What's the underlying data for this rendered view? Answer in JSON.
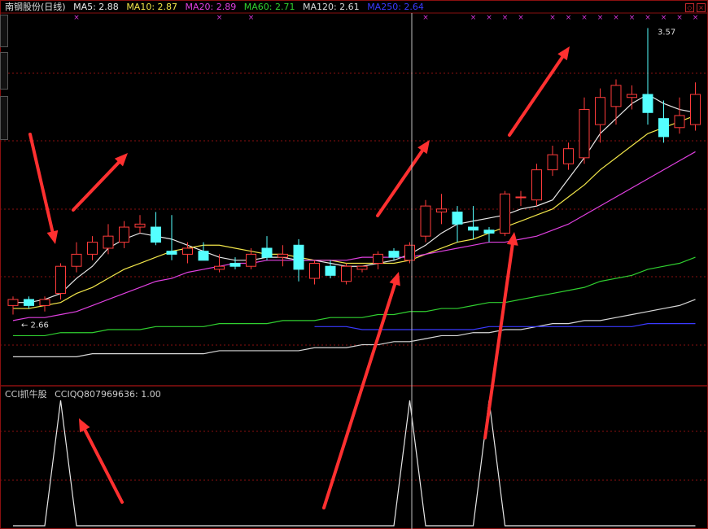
{
  "header": {
    "title": "南钢股份(日线)",
    "ma_items": [
      {
        "label": "MA5: 2.88",
        "color": "#e8e8e8"
      },
      {
        "label": "MA10: 2.87",
        "color": "#f2e64a"
      },
      {
        "label": "MA20: 2.89",
        "color": "#e040e0"
      },
      {
        "label": "MA60: 2.71",
        "color": "#30d030"
      },
      {
        "label": "MA120: 2.61",
        "color": "#d8d8d8"
      },
      {
        "label": "MA250: 2.64",
        "color": "#3a3aff"
      }
    ]
  },
  "indicator": {
    "name": "CCI抓牛股",
    "value_label": "CCIQQ807969636: 1.00"
  },
  "annotations": {
    "low_label": "2.66",
    "high_label": "3.57"
  },
  "colors": {
    "up": "#ff3b3b",
    "down": "#54ffff",
    "grid": "#8a1010",
    "crosshair": "#bfbfbf",
    "marker": "#d838d8",
    "arrow": "#ff3030"
  },
  "chart_data": {
    "type": "candlestick",
    "title": "南钢股份(日线)",
    "price_range": [
      2.4,
      3.62
    ],
    "candles": [
      {
        "o": 2.65,
        "h": 2.68,
        "l": 2.62,
        "c": 2.67,
        "up": true
      },
      {
        "o": 2.67,
        "h": 2.68,
        "l": 2.64,
        "c": 2.65,
        "up": false
      },
      {
        "o": 2.65,
        "h": 2.68,
        "l": 2.63,
        "c": 2.67,
        "up": true
      },
      {
        "o": 2.69,
        "h": 2.79,
        "l": 2.67,
        "c": 2.78,
        "up": true
      },
      {
        "o": 2.78,
        "h": 2.86,
        "l": 2.76,
        "c": 2.82,
        "up": true
      },
      {
        "o": 2.82,
        "h": 2.88,
        "l": 2.8,
        "c": 2.86,
        "up": true
      },
      {
        "o": 2.84,
        "h": 2.92,
        "l": 2.82,
        "c": 2.88,
        "up": true
      },
      {
        "o": 2.86,
        "h": 2.93,
        "l": 2.84,
        "c": 2.91,
        "up": true
      },
      {
        "o": 2.91,
        "h": 2.95,
        "l": 2.89,
        "c": 2.92,
        "up": true
      },
      {
        "o": 2.91,
        "h": 2.96,
        "l": 2.85,
        "c": 2.86,
        "up": false
      },
      {
        "o": 2.83,
        "h": 2.95,
        "l": 2.8,
        "c": 2.82,
        "up": false
      },
      {
        "o": 2.82,
        "h": 2.86,
        "l": 2.79,
        "c": 2.84,
        "up": true
      },
      {
        "o": 2.83,
        "h": 2.86,
        "l": 2.8,
        "c": 2.8,
        "up": false
      },
      {
        "o": 2.78,
        "h": 2.82,
        "l": 2.76,
        "c": 2.77,
        "up": true
      },
      {
        "o": 2.79,
        "h": 2.81,
        "l": 2.77,
        "c": 2.78,
        "up": false
      },
      {
        "o": 2.78,
        "h": 2.84,
        "l": 2.77,
        "c": 2.82,
        "up": true
      },
      {
        "o": 2.84,
        "h": 2.88,
        "l": 2.8,
        "c": 2.81,
        "up": false
      },
      {
        "o": 2.81,
        "h": 2.85,
        "l": 2.78,
        "c": 2.82,
        "up": true
      },
      {
        "o": 2.85,
        "h": 2.87,
        "l": 2.73,
        "c": 2.77,
        "up": false
      },
      {
        "o": 2.74,
        "h": 2.8,
        "l": 2.72,
        "c": 2.79,
        "up": true
      },
      {
        "o": 2.78,
        "h": 2.8,
        "l": 2.74,
        "c": 2.75,
        "up": false
      },
      {
        "o": 2.73,
        "h": 2.79,
        "l": 2.72,
        "c": 2.78,
        "up": true
      },
      {
        "o": 2.77,
        "h": 2.78,
        "l": 2.76,
        "c": 2.78,
        "up": true
      },
      {
        "o": 2.79,
        "h": 2.83,
        "l": 2.77,
        "c": 2.82,
        "up": true
      },
      {
        "o": 2.83,
        "h": 2.84,
        "l": 2.8,
        "c": 2.81,
        "up": false
      },
      {
        "o": 2.8,
        "h": 2.86,
        "l": 2.79,
        "c": 2.85,
        "up": true
      },
      {
        "o": 2.88,
        "h": 3.0,
        "l": 2.86,
        "c": 2.98,
        "up": true
      },
      {
        "o": 2.96,
        "h": 3.02,
        "l": 2.92,
        "c": 2.97,
        "up": true
      },
      {
        "o": 2.96,
        "h": 2.98,
        "l": 2.86,
        "c": 2.92,
        "up": false
      },
      {
        "o": 2.91,
        "h": 2.98,
        "l": 2.87,
        "c": 2.9,
        "up": false
      },
      {
        "o": 2.9,
        "h": 2.91,
        "l": 2.86,
        "c": 2.89,
        "up": false
      },
      {
        "o": 2.89,
        "h": 3.03,
        "l": 2.88,
        "c": 3.02,
        "up": true
      },
      {
        "o": 3.01,
        "h": 3.03,
        "l": 2.98,
        "c": 3.01,
        "up": true
      },
      {
        "o": 3.0,
        "h": 3.12,
        "l": 2.98,
        "c": 3.1,
        "up": true
      },
      {
        "o": 3.1,
        "h": 3.18,
        "l": 3.08,
        "c": 3.15,
        "up": true
      },
      {
        "o": 3.12,
        "h": 3.19,
        "l": 3.1,
        "c": 3.17,
        "up": true
      },
      {
        "o": 3.14,
        "h": 3.34,
        "l": 3.12,
        "c": 3.3,
        "up": true
      },
      {
        "o": 3.25,
        "h": 3.37,
        "l": 3.19,
        "c": 3.34,
        "up": true
      },
      {
        "o": 3.31,
        "h": 3.4,
        "l": 3.25,
        "c": 3.38,
        "up": true
      },
      {
        "o": 3.34,
        "h": 3.38,
        "l": 3.3,
        "c": 3.35,
        "up": true
      },
      {
        "o": 3.35,
        "h": 3.57,
        "l": 3.25,
        "c": 3.29,
        "up": false
      },
      {
        "o": 3.27,
        "h": 3.33,
        "l": 3.19,
        "c": 3.21,
        "up": false
      },
      {
        "o": 3.24,
        "h": 3.34,
        "l": 3.22,
        "c": 3.28,
        "up": true
      },
      {
        "o": 3.25,
        "h": 3.39,
        "l": 3.23,
        "c": 3.35,
        "up": true
      }
    ],
    "moving_averages": [
      {
        "name": "MA5",
        "values": [
          2.66,
          2.66,
          2.67,
          2.69,
          2.74,
          2.78,
          2.84,
          2.87,
          2.89,
          2.88,
          2.87,
          2.85,
          2.83,
          2.81,
          2.8,
          2.8,
          2.81,
          2.81,
          2.8,
          2.8,
          2.79,
          2.78,
          2.78,
          2.79,
          2.8,
          2.82,
          2.85,
          2.89,
          2.92,
          2.93,
          2.94,
          2.95,
          2.97,
          2.98,
          3.0,
          3.07,
          3.14,
          3.22,
          3.27,
          3.32,
          3.35,
          3.32,
          3.3,
          3.29
        ]
      },
      {
        "name": "MA10",
        "values": [
          2.64,
          2.64,
          2.65,
          2.66,
          2.69,
          2.71,
          2.74,
          2.77,
          2.79,
          2.81,
          2.83,
          2.84,
          2.85,
          2.85,
          2.84,
          2.83,
          2.82,
          2.82,
          2.81,
          2.8,
          2.8,
          2.79,
          2.79,
          2.79,
          2.79,
          2.8,
          2.82,
          2.84,
          2.86,
          2.87,
          2.89,
          2.91,
          2.93,
          2.95,
          2.97,
          3.01,
          3.05,
          3.1,
          3.14,
          3.18,
          3.22,
          3.24,
          3.26,
          3.28
        ]
      },
      {
        "name": "MA20",
        "values": [
          2.6,
          2.61,
          2.61,
          2.62,
          2.63,
          2.65,
          2.67,
          2.69,
          2.71,
          2.73,
          2.74,
          2.76,
          2.77,
          2.78,
          2.79,
          2.79,
          2.8,
          2.8,
          2.8,
          2.8,
          2.8,
          2.8,
          2.81,
          2.81,
          2.81,
          2.81,
          2.82,
          2.83,
          2.84,
          2.85,
          2.86,
          2.86,
          2.87,
          2.88,
          2.9,
          2.92,
          2.95,
          2.98,
          3.01,
          3.04,
          3.07,
          3.1,
          3.13,
          3.16
        ]
      },
      {
        "name": "MA60",
        "values": [
          2.55,
          2.55,
          2.55,
          2.56,
          2.56,
          2.56,
          2.57,
          2.57,
          2.57,
          2.58,
          2.58,
          2.58,
          2.58,
          2.59,
          2.59,
          2.59,
          2.59,
          2.6,
          2.6,
          2.6,
          2.61,
          2.61,
          2.61,
          2.62,
          2.62,
          2.63,
          2.63,
          2.64,
          2.64,
          2.65,
          2.66,
          2.66,
          2.67,
          2.68,
          2.69,
          2.7,
          2.71,
          2.73,
          2.74,
          2.75,
          2.77,
          2.78,
          2.79,
          2.81
        ]
      },
      {
        "name": "MA120",
        "values": [
          2.48,
          2.48,
          2.48,
          2.48,
          2.48,
          2.49,
          2.49,
          2.49,
          2.49,
          2.49,
          2.49,
          2.49,
          2.49,
          2.5,
          2.5,
          2.5,
          2.5,
          2.5,
          2.5,
          2.51,
          2.51,
          2.51,
          2.52,
          2.52,
          2.53,
          2.53,
          2.54,
          2.55,
          2.55,
          2.56,
          2.56,
          2.57,
          2.57,
          2.58,
          2.59,
          2.59,
          2.6,
          2.6,
          2.61,
          2.62,
          2.63,
          2.64,
          2.65,
          2.67
        ]
      },
      {
        "name": "MA250",
        "values": [
          null,
          null,
          null,
          null,
          null,
          null,
          null,
          null,
          null,
          null,
          null,
          null,
          null,
          null,
          null,
          null,
          null,
          null,
          null,
          2.58,
          2.58,
          2.58,
          2.57,
          2.57,
          2.57,
          2.57,
          2.57,
          2.57,
          2.57,
          2.57,
          2.58,
          2.58,
          2.58,
          2.58,
          2.58,
          2.58,
          2.58,
          2.58,
          2.58,
          2.58,
          2.59,
          2.59,
          2.59,
          2.59
        ]
      }
    ],
    "indicator_series": {
      "name": "CCIQQ807969636",
      "values": [
        0,
        0,
        0,
        1,
        0,
        0,
        0,
        0,
        0,
        0,
        0,
        0,
        0,
        0,
        0,
        0,
        0,
        0,
        0,
        0,
        0,
        0,
        0,
        0,
        0,
        1,
        0,
        0,
        0,
        0,
        1,
        0,
        0,
        0,
        0,
        0,
        0,
        0,
        0,
        0,
        0,
        0,
        0,
        0
      ]
    },
    "signal_markers": [
      4,
      13,
      15,
      26,
      29,
      30,
      31,
      32,
      34,
      35,
      36,
      37,
      38,
      39,
      40,
      41,
      42,
      43
    ]
  }
}
